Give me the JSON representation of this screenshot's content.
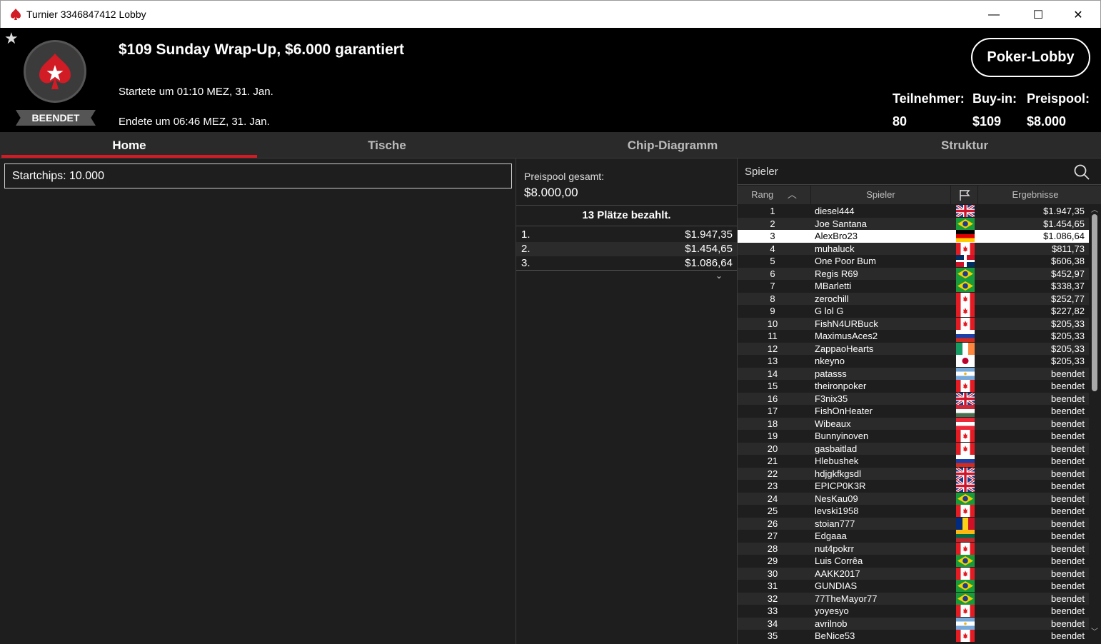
{
  "window": {
    "title": "Turnier 3346847412 Lobby",
    "min_glyph": "—",
    "max_glyph": "☐",
    "close_glyph": "✕"
  },
  "header": {
    "status": "BEENDET",
    "title": "$109 Sunday Wrap-Up, $6.000 garantiert",
    "started": "Startete um 01:10 MEZ, 31. Jan.",
    "ended": "Endete um 06:46 MEZ, 31. Jan.",
    "lobby_button": "Poker-Lobby",
    "participants_label": "Teilnehmer:",
    "participants_value": "80",
    "buyin_label": "Buy-in:",
    "buyin_value": "$109",
    "prizepool_label": "Preispool:",
    "prizepool_value": "$8.000"
  },
  "tabs": [
    "Home",
    "Tische",
    "Chip-Diagramm",
    "Struktur"
  ],
  "home": {
    "startchips": "Startchips:  10.000"
  },
  "prizes": {
    "pool_label": "Preispool gesamt:",
    "pool_value": "$8.000,00",
    "paid_label": "13 Plätze bezahlt.",
    "rows": [
      {
        "rank": "1.",
        "amount": "$1.947,35"
      },
      {
        "rank": "2.",
        "amount": "$1.454,65"
      },
      {
        "rank": "3.",
        "amount": "$1.086,64"
      }
    ]
  },
  "players": {
    "search_label": "Spieler",
    "headers": {
      "rank": "Rang",
      "player": "Spieler",
      "results": "Ergebnisse"
    },
    "rows": [
      {
        "rank": "1",
        "name": "diesel444",
        "flag": "gb",
        "result": "$1.947,35"
      },
      {
        "rank": "2",
        "name": "Joe Santana",
        "flag": "br",
        "result": "$1.454,65"
      },
      {
        "rank": "3",
        "name": "AlexBro23",
        "flag": "de",
        "result": "$1.086,64"
      },
      {
        "rank": "4",
        "name": "muhaluck",
        "flag": "ca",
        "result": "$811,73"
      },
      {
        "rank": "5",
        "name": "One Poor Bum",
        "flag": "do",
        "result": "$606,38"
      },
      {
        "rank": "6",
        "name": "Regis R69",
        "flag": "br",
        "result": "$452,97"
      },
      {
        "rank": "7",
        "name": "MBarletti",
        "flag": "br",
        "result": "$338,37"
      },
      {
        "rank": "8",
        "name": "zerochill",
        "flag": "ca",
        "result": "$252,77"
      },
      {
        "rank": "9",
        "name": "G lol G",
        "flag": "ca",
        "result": "$227,82"
      },
      {
        "rank": "10",
        "name": "FishN4URBuck",
        "flag": "ca",
        "result": "$205,33"
      },
      {
        "rank": "11",
        "name": "MaximusAces2",
        "flag": "ru",
        "result": "$205,33"
      },
      {
        "rank": "12",
        "name": "ZappaoHearts",
        "flag": "ie",
        "result": "$205,33"
      },
      {
        "rank": "13",
        "name": "nkeyno",
        "flag": "jp",
        "result": "$205,33"
      },
      {
        "rank": "14",
        "name": "patasss",
        "flag": "ar",
        "result": "beendet"
      },
      {
        "rank": "15",
        "name": "theironpoker",
        "flag": "ca",
        "result": "beendet"
      },
      {
        "rank": "16",
        "name": "F3nix35",
        "flag": "gb",
        "result": "beendet"
      },
      {
        "rank": "17",
        "name": "FishOnHeater",
        "flag": "hu",
        "result": "beendet"
      },
      {
        "rank": "18",
        "name": "Wibeaux",
        "flag": "at",
        "result": "beendet"
      },
      {
        "rank": "19",
        "name": "Bunnyinoven",
        "flag": "ca",
        "result": "beendet"
      },
      {
        "rank": "20",
        "name": "gasbaitlad",
        "flag": "ca",
        "result": "beendet"
      },
      {
        "rank": "21",
        "name": "Hlebushek",
        "flag": "ru",
        "result": "beendet"
      },
      {
        "rank": "22",
        "name": "hdjgkfkgsdl",
        "flag": "gb",
        "result": "beendet"
      },
      {
        "rank": "23",
        "name": "EPICP0K3R",
        "flag": "gb",
        "result": "beendet"
      },
      {
        "rank": "24",
        "name": "NesKau09",
        "flag": "br",
        "result": "beendet"
      },
      {
        "rank": "25",
        "name": "levski1958",
        "flag": "ca",
        "result": "beendet"
      },
      {
        "rank": "26",
        "name": "stoian777",
        "flag": "ro",
        "result": "beendet"
      },
      {
        "rank": "27",
        "name": "Edgaaa",
        "flag": "lt",
        "result": "beendet"
      },
      {
        "rank": "28",
        "name": "nut4pokrr",
        "flag": "ca",
        "result": "beendet"
      },
      {
        "rank": "29",
        "name": "Luis Corrêa",
        "flag": "br",
        "result": "beendet"
      },
      {
        "rank": "30",
        "name": "AAKK2017",
        "flag": "ca",
        "result": "beendet"
      },
      {
        "rank": "31",
        "name": "GUNDIAS",
        "flag": "br",
        "result": "beendet"
      },
      {
        "rank": "32",
        "name": "77TheMayor77",
        "flag": "br",
        "result": "beendet"
      },
      {
        "rank": "33",
        "name": "yoyesyo",
        "flag": "ca",
        "result": "beendet"
      },
      {
        "rank": "34",
        "name": "avrilnob",
        "flag": "ar",
        "result": "beendet"
      },
      {
        "rank": "35",
        "name": "BeNice53",
        "flag": "ca",
        "result": "beendet"
      }
    ],
    "highlighted_rank": "3"
  },
  "colors": {
    "accent": "#d11b25",
    "background": "#1e1e1e",
    "header": "#000000"
  }
}
